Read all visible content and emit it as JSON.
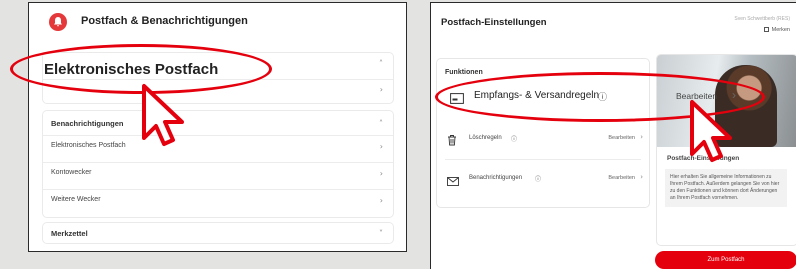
{
  "left": {
    "header_title": "Postfach & Benachrichtigungen",
    "highlight_label": "Elektronisches Postfach",
    "notifications_heading": "Benachrichtigungen",
    "notification_items": [
      "Elektronisches Postfach",
      "Kontowecker",
      "Weitere Wecker"
    ],
    "merkzettel_label": "Merkzettel",
    "chevron_right": "›",
    "chevron_up": "˄",
    "chevron_down": "˅"
  },
  "right": {
    "title": "Postfach-Einstellungen",
    "user_name": "Sven Schwettberb (RES)",
    "merken_label": "Merken",
    "functions_heading": "Funktionen",
    "rules_label": "Empfangs- & Versandregeln",
    "rules_info": "ⓘ",
    "rules_edit": "Bearbeiten",
    "delete_label": "Löschregeln",
    "delete_edit": "Bearbeiten",
    "notify_label": "Benachrichtigungen",
    "notify_edit": "Bearbeiten",
    "info_card_title": "Postfach-Einstellungen",
    "info_card_text": "Hier erhalten Sie allgemeine Informationen zu Ihrem Postfach. Außerdem gelangen Sie von hier zu den Funktionen und können dort Änderungen an Ihrem Postfach vornehmen.",
    "button_label": "Zum Postfach"
  },
  "colors": {
    "accent": "#e5000d",
    "bell": "#e4383a",
    "background": "#e3e3e1"
  },
  "icons": [
    "bell-icon",
    "mailbox-icon",
    "trash-icon",
    "envelope-icon",
    "info-icon",
    "chevron-right-icon",
    "cursor-icon"
  ]
}
